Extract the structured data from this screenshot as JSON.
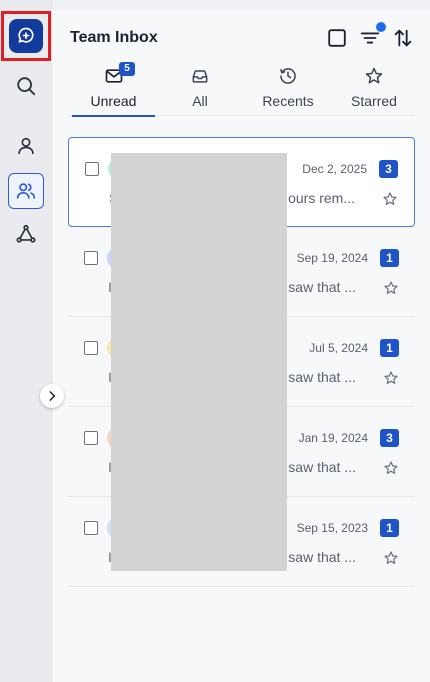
{
  "rail": {
    "items": [
      {
        "name": "compose-icon",
        "active": false
      },
      {
        "name": "search-icon",
        "active": false
      },
      {
        "name": "user-icon",
        "active": false
      },
      {
        "name": "team-icon",
        "active": true
      },
      {
        "name": "network-icon",
        "active": false
      }
    ]
  },
  "header": {
    "title": "Team Inbox",
    "icons": [
      "select-all-checkbox",
      "filter-icon",
      "sort-icon"
    ]
  },
  "tabs": [
    {
      "label": "Unread",
      "icon": "mail-icon",
      "badge": "5",
      "active": true
    },
    {
      "label": "All",
      "icon": "inbox-icon",
      "badge": "",
      "active": false
    },
    {
      "label": "Recents",
      "icon": "clock-icon",
      "badge": "",
      "active": false
    },
    {
      "label": "Starred",
      "icon": "star-icon",
      "badge": "",
      "active": false
    }
  ],
  "conversations": [
    {
      "date": "Dec 2, 2025",
      "count": "3",
      "snippet_start": "S",
      "snippet": "ours rem...",
      "avatar_color": "#b8f0d8",
      "selected": true
    },
    {
      "date": "Sep 19, 2024",
      "count": "1",
      "snippet_start": "I",
      "snippet": "saw that ...",
      "avatar_color": "#c9d6fb",
      "selected": false
    },
    {
      "date": "Jul 5, 2024",
      "count": "1",
      "snippet_start": "I",
      "snippet": "saw that ...",
      "avatar_color": "#fbe7a8",
      "selected": false
    },
    {
      "date": "Jan 19, 2024",
      "count": "3",
      "snippet_start": "I",
      "snippet": "saw that ...",
      "avatar_color": "#fcd5c2",
      "selected": false
    },
    {
      "date": "Sep 15, 2023",
      "count": "1",
      "snippet_start": "I",
      "snippet": "saw that ...",
      "avatar_color": "#c7e3fa",
      "selected": false
    }
  ],
  "colors": {
    "accent": "#1f54c9",
    "compose_bg": "#123a9c",
    "highlight_border": "#e11d24",
    "redaction": "#d3d3d3"
  }
}
